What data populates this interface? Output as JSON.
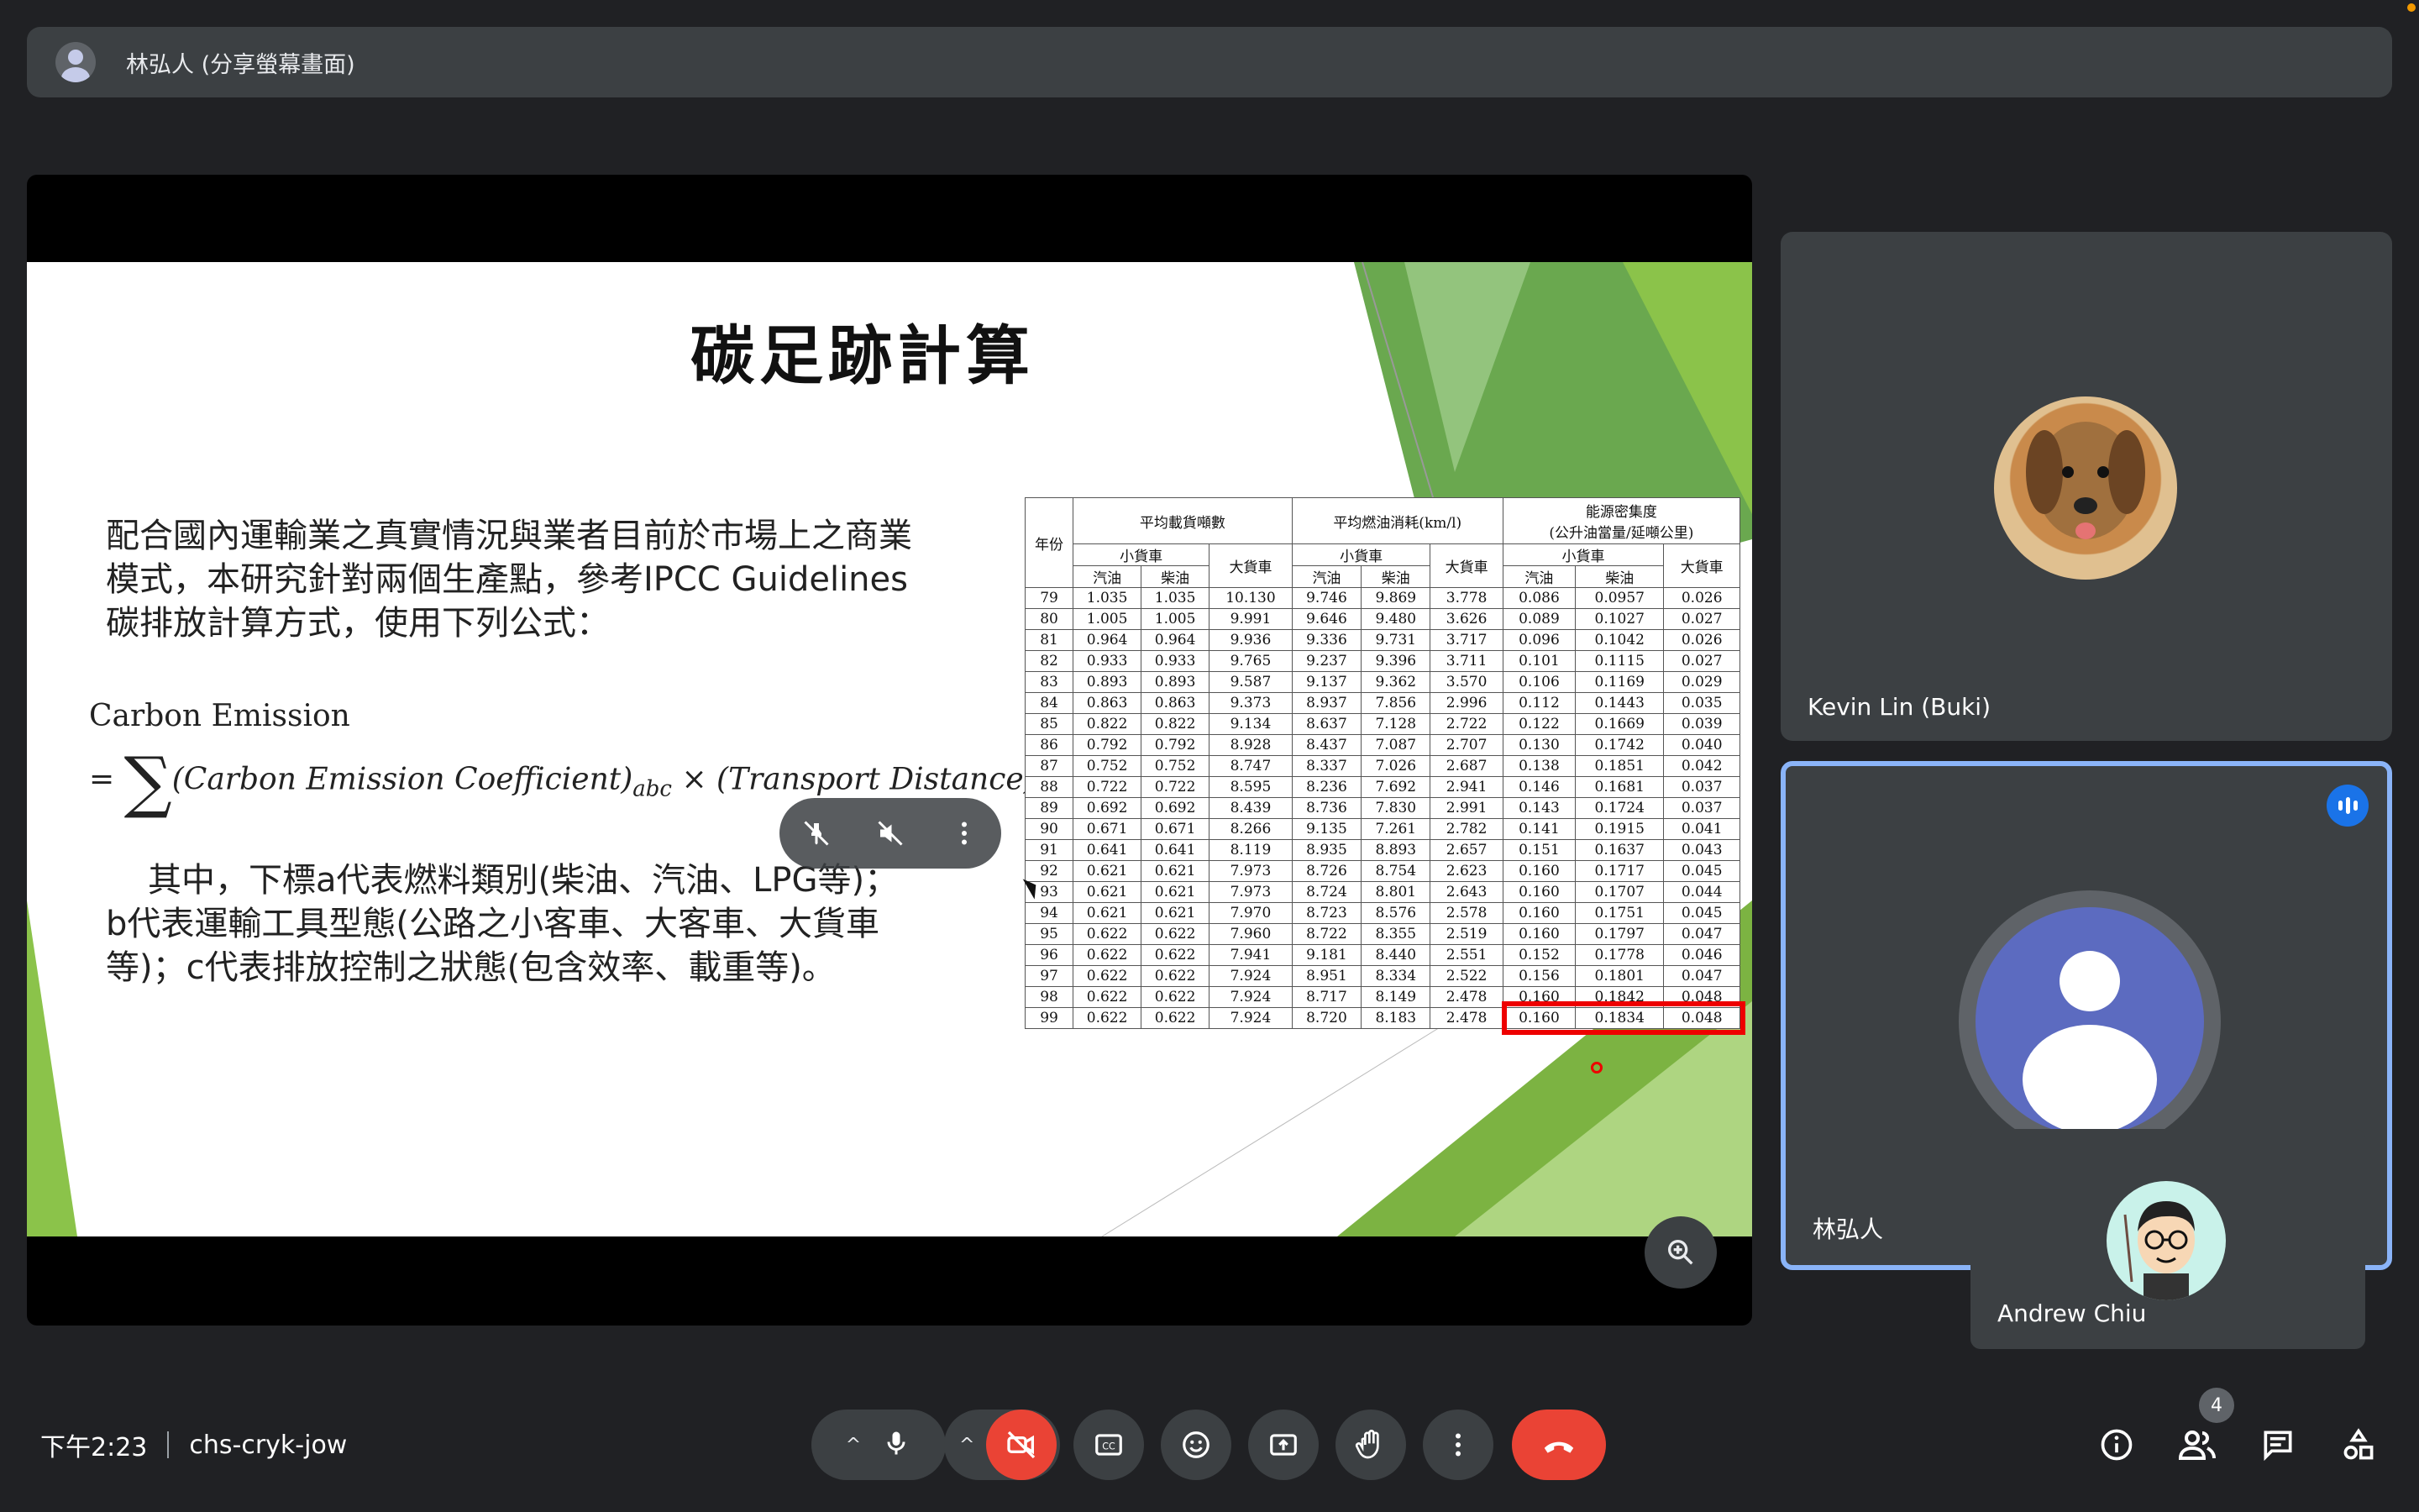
{
  "presenter": {
    "title": "林弘人 (分享螢幕畫面)"
  },
  "slide": {
    "title": "碳足跡計算",
    "para1": "配合國內運輸業之真實情況與業者目前於市場上之商業模式，本研究針對兩個生產點，參考IPCC Guidelines碳排放計算方式，使用下列公式：",
    "ce_label": "Carbon Emission",
    "formula_eq": "=",
    "formula_sigma": "∑",
    "formula_term1": "(Carbon Emission Coefficient)",
    "formula_sub": "abc",
    "formula_term2": "× (Transport Distance)",
    "para2": "其中，下標a代表燃料類別(柴油、汽油、LPG等)；b代表運輸工具型態(公路之小客車、大客車、大貨車等)；c代表排放控制之狀態(包含效率、載重等)。"
  },
  "table": {
    "h_year": "年份",
    "h_load": "平均載貨噸數",
    "h_fuel": "平均燃油消耗(km/l)",
    "h_energy": "能源密集度",
    "h_energy_unit": "(公升油當量/延噸公里)",
    "h_small": "小貨車",
    "h_large": "大貨車",
    "h_large2": "大貨車",
    "h_gas": "汽油",
    "h_diesel": "柴油",
    "rows": [
      [
        "79",
        "1.035",
        "1.035",
        "10.130",
        "9.746",
        "9.869",
        "3.778",
        "0.086",
        "0.0957",
        "0.026"
      ],
      [
        "80",
        "1.005",
        "1.005",
        "9.991",
        "9.646",
        "9.480",
        "3.626",
        "0.089",
        "0.1027",
        "0.027"
      ],
      [
        "81",
        "0.964",
        "0.964",
        "9.936",
        "9.336",
        "9.731",
        "3.717",
        "0.096",
        "0.1042",
        "0.026"
      ],
      [
        "82",
        "0.933",
        "0.933",
        "9.765",
        "9.237",
        "9.396",
        "3.711",
        "0.101",
        "0.1115",
        "0.027"
      ],
      [
        "83",
        "0.893",
        "0.893",
        "9.587",
        "9.137",
        "9.362",
        "3.570",
        "0.106",
        "0.1169",
        "0.029"
      ],
      [
        "84",
        "0.863",
        "0.863",
        "9.373",
        "8.937",
        "7.856",
        "2.996",
        "0.112",
        "0.1443",
        "0.035"
      ],
      [
        "85",
        "0.822",
        "0.822",
        "9.134",
        "8.637",
        "7.128",
        "2.722",
        "0.122",
        "0.1669",
        "0.039"
      ],
      [
        "86",
        "0.792",
        "0.792",
        "8.928",
        "8.437",
        "7.087",
        "2.707",
        "0.130",
        "0.1742",
        "0.040"
      ],
      [
        "87",
        "0.752",
        "0.752",
        "8.747",
        "8.337",
        "7.026",
        "2.687",
        "0.138",
        "0.1851",
        "0.042"
      ],
      [
        "88",
        "0.722",
        "0.722",
        "8.595",
        "8.236",
        "7.692",
        "2.941",
        "0.146",
        "0.1681",
        "0.037"
      ],
      [
        "89",
        "0.692",
        "0.692",
        "8.439",
        "8.736",
        "7.830",
        "2.991",
        "0.143",
        "0.1724",
        "0.037"
      ],
      [
        "90",
        "0.671",
        "0.671",
        "8.266",
        "9.135",
        "7.261",
        "2.782",
        "0.141",
        "0.1915",
        "0.041"
      ],
      [
        "91",
        "0.641",
        "0.641",
        "8.119",
        "8.935",
        "8.893",
        "2.657",
        "0.151",
        "0.1637",
        "0.043"
      ],
      [
        "92",
        "0.621",
        "0.621",
        "7.973",
        "8.726",
        "8.754",
        "2.623",
        "0.160",
        "0.1717",
        "0.045"
      ],
      [
        "93",
        "0.621",
        "0.621",
        "7.973",
        "8.724",
        "8.801",
        "2.643",
        "0.160",
        "0.1707",
        "0.044"
      ],
      [
        "94",
        "0.621",
        "0.621",
        "7.970",
        "8.723",
        "8.576",
        "2.578",
        "0.160",
        "0.1751",
        "0.045"
      ],
      [
        "95",
        "0.622",
        "0.622",
        "7.960",
        "8.722",
        "8.355",
        "2.519",
        "0.160",
        "0.1797",
        "0.047"
      ],
      [
        "96",
        "0.622",
        "0.622",
        "7.941",
        "9.181",
        "8.440",
        "2.551",
        "0.152",
        "0.1778",
        "0.046"
      ],
      [
        "97",
        "0.622",
        "0.622",
        "7.924",
        "8.951",
        "8.334",
        "2.522",
        "0.156",
        "0.1801",
        "0.047"
      ],
      [
        "98",
        "0.622",
        "0.622",
        "7.924",
        "8.717",
        "8.149",
        "2.478",
        "0.160",
        "0.1842",
        "0.048"
      ],
      [
        "99",
        "0.622",
        "0.622",
        "7.924",
        "8.720",
        "8.183",
        "2.478",
        "0.160",
        "0.1834",
        "0.048"
      ]
    ]
  },
  "participants": {
    "kevin": "Kevin Lin (Buki)",
    "lin": "林弘人",
    "andrew": "Andrew Chiu"
  },
  "bottom": {
    "time": "下午2:23",
    "meeting_code": "chs-cryk-jow",
    "people_count": "4"
  },
  "colors": {
    "accent": "#8ab4f8",
    "end_call": "#ea4335",
    "bg": "#202124"
  }
}
